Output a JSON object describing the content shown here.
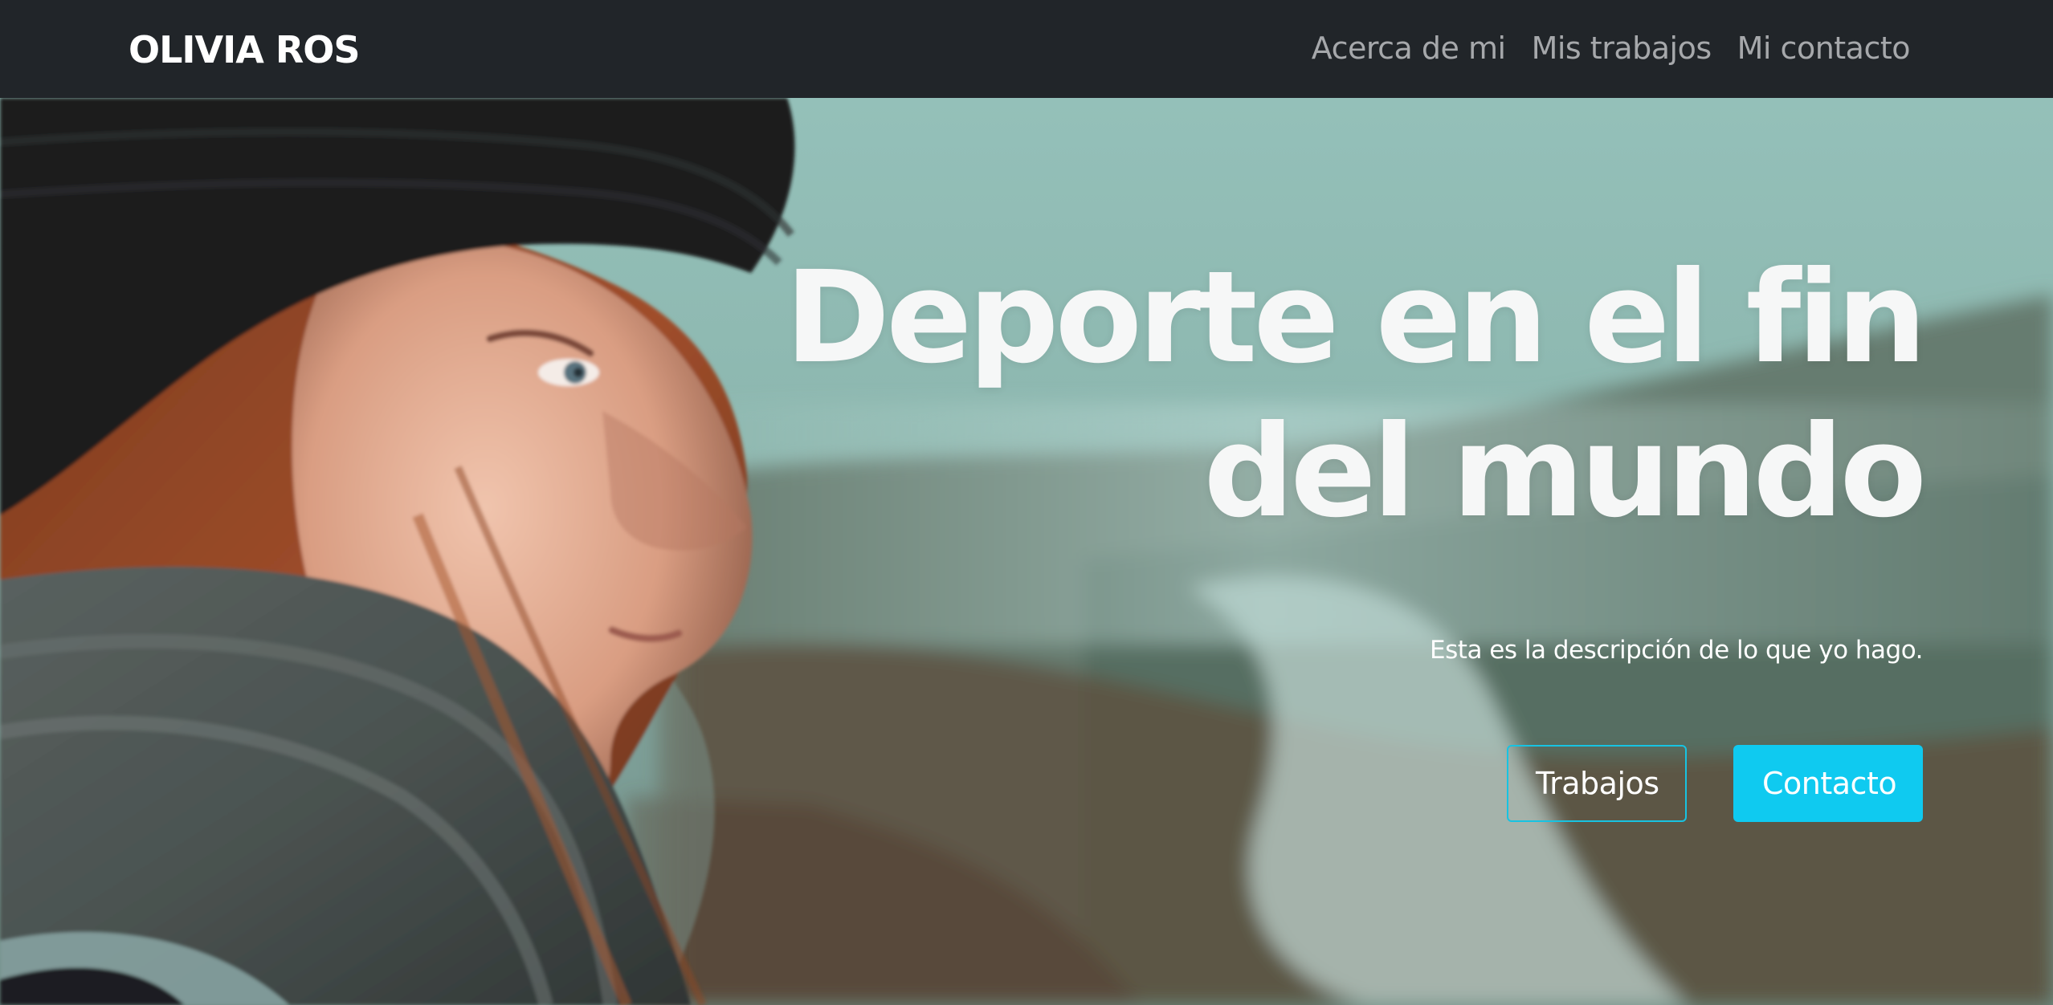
{
  "navbar": {
    "brand": "OLIVIA ROS",
    "links": [
      "Acerca de mi",
      "Mis trabajos",
      "Mi contacto"
    ]
  },
  "hero": {
    "title_line1": "Deporte en el fin",
    "title_line2": "del mundo",
    "description": "Esta es la descripción de lo que yo hago.",
    "buttons": {
      "works": "Trabajos",
      "contact": "Contacto"
    }
  },
  "colors": {
    "navbar_bg": "#212529",
    "accent_cyan": "#0fcaf0",
    "nav_text": "#a6a8ab"
  }
}
